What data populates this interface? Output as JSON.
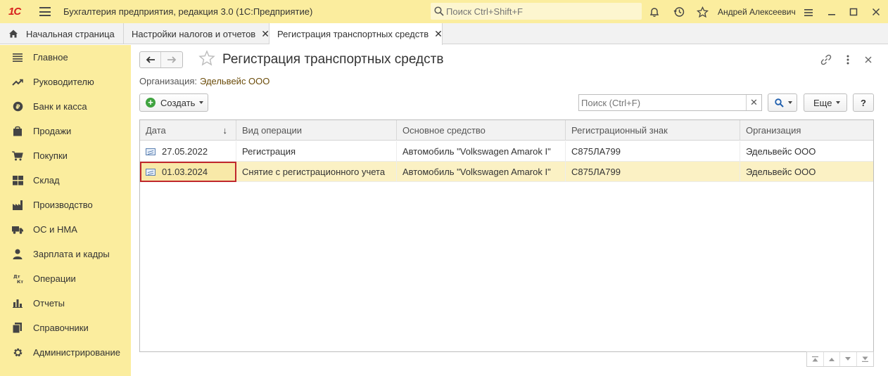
{
  "app": {
    "logo": "1С",
    "title": "Бухгалтерия предприятия, редакция 3.0  (1С:Предприятие)",
    "search_placeholder": "Поиск Ctrl+Shift+F",
    "user": "Андрей Алексеевич"
  },
  "tabs": [
    {
      "label": "Начальная страница",
      "icon": "home-icon"
    },
    {
      "label": "Настройки налогов и отчетов",
      "closable": true
    },
    {
      "label": "Регистрация транспортных средств",
      "closable": true,
      "active": true
    }
  ],
  "sidebar": {
    "items": [
      {
        "label": "Главное",
        "icon": "menu-lines-icon"
      },
      {
        "label": "Руководителю",
        "icon": "trend-icon"
      },
      {
        "label": "Банк и касса",
        "icon": "coin-icon"
      },
      {
        "label": "Продажи",
        "icon": "bag-icon"
      },
      {
        "label": "Покупки",
        "icon": "cart-icon"
      },
      {
        "label": "Склад",
        "icon": "warehouse-icon"
      },
      {
        "label": "Производство",
        "icon": "factory-icon"
      },
      {
        "label": "ОС и НМА",
        "icon": "truck-icon"
      },
      {
        "label": "Зарплата и кадры",
        "icon": "person-icon"
      },
      {
        "label": "Операции",
        "icon": "dt-kt-icon"
      },
      {
        "label": "Отчеты",
        "icon": "bar-chart-icon"
      },
      {
        "label": "Справочники",
        "icon": "book-icon"
      },
      {
        "label": "Администрирование",
        "icon": "gear-icon"
      }
    ]
  },
  "page": {
    "title": "Регистрация транспортных средств",
    "org_label": "Организация:",
    "org_value": "Эдельвейс ООО",
    "create_label": "Создать",
    "search_placeholder": "Поиск (Ctrl+F)",
    "more_label": "Еще",
    "help_label": "?"
  },
  "table": {
    "columns": [
      "Дата",
      "Вид операции",
      "Основное средство",
      "Регистрационный знак",
      "Организация"
    ],
    "sort_indicator": "↓",
    "rows": [
      {
        "date": "27.05.2022",
        "operation": "Регистрация",
        "asset": "Автомобиль \"Volkswagen Amarok I\"",
        "plate": "С875ЛА799",
        "org": "Эдельвейс ООО"
      },
      {
        "date": "01.03.2024",
        "operation": "Снятие с регистрационного учета",
        "asset": "Автомобиль \"Volkswagen Amarok I\"",
        "plate": "С875ЛА799",
        "org": "Эдельвейс ООО",
        "selected": true
      }
    ]
  },
  "colors": {
    "chrome_yellow": "#fbed9e",
    "selected_row": "#fbf1c4",
    "focus_border": "#c0282d",
    "org_link": "#6b4c0a",
    "create_green": "#3fa33f"
  }
}
